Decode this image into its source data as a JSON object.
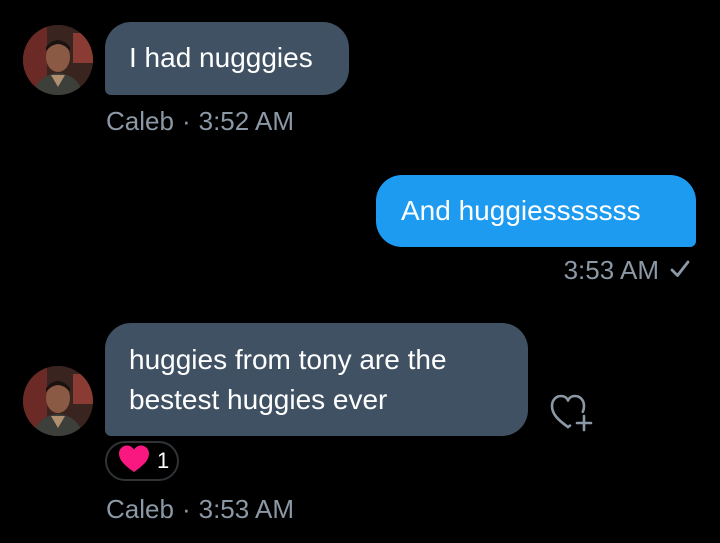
{
  "colors": {
    "received_bubble": "#3f5163",
    "sent_bubble": "#1d9bf0",
    "meta_text": "#8b98a5",
    "heart": "#f91880",
    "background": "#000000"
  },
  "messages": [
    {
      "direction": "received",
      "text": "I had nugggies",
      "sender": "Caleb",
      "separator": "·",
      "time": "3:52 AM"
    },
    {
      "direction": "sent",
      "text": "And huggiesssssss",
      "time": "3:53 AM",
      "status_icon": "check-icon"
    },
    {
      "direction": "received",
      "text_line1": "huggies from tony are the",
      "text_line2": "bestest huggies ever",
      "sender": "Caleb",
      "separator": "·",
      "time": "3:53 AM",
      "reaction": {
        "icon": "heart-icon",
        "count": "1"
      },
      "add_reaction_icon": "heart-plus-icon"
    }
  ]
}
